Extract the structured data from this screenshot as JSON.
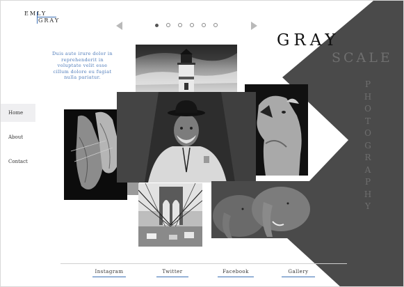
{
  "logo": {
    "line1": "EMLY",
    "line2": "GRAY"
  },
  "slider": {
    "slides": 6,
    "active_index": 0,
    "prev_icon": "triangle-left-icon",
    "next_icon": "triangle-right-icon"
  },
  "intro_text": "Duis aute irure dolor in reprehenderit in voluptate velit esse cillum dolore eu fugiat nulla pariatur.",
  "title": {
    "word1": "GRAY",
    "word2": "SCALE",
    "vertical_letters": [
      "P",
      "H",
      "O",
      "T",
      "O",
      "G",
      "R",
      "A",
      "P",
      "H",
      "Y"
    ]
  },
  "nav": {
    "items": [
      {
        "label": "Home",
        "active": true
      },
      {
        "label": "About",
        "active": false
      },
      {
        "label": "Contact",
        "active": false
      }
    ]
  },
  "footer": {
    "links": [
      {
        "label": "Instagram"
      },
      {
        "label": "Twitter"
      },
      {
        "label": "Facebook"
      },
      {
        "label": "Gallery"
      }
    ]
  },
  "colors": {
    "accent": "#3b6fb5",
    "dark_panel": "#4a4a4a",
    "background": "#ffffff"
  }
}
